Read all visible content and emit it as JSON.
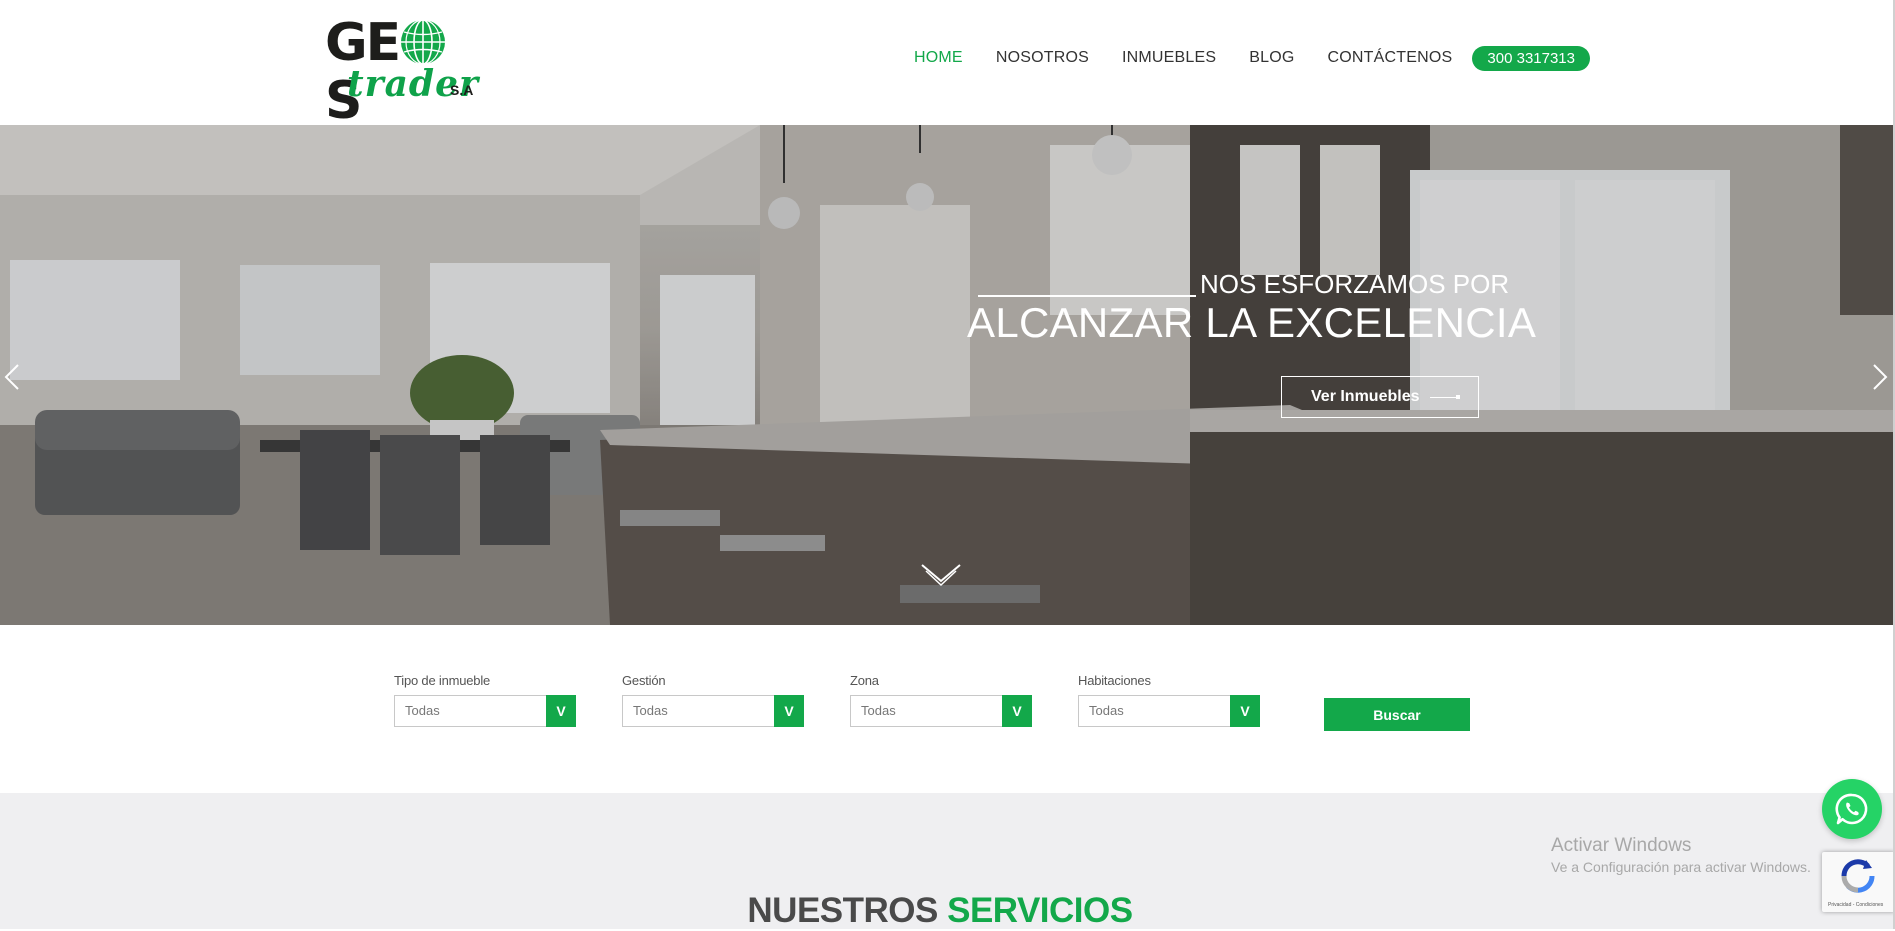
{
  "header": {
    "logo": {
      "brand_text_1": "GE",
      "brand_text_2": "S",
      "brand_text_sub": "trader",
      "brand_suffix": "S.A"
    },
    "nav": [
      {
        "label": "HOME",
        "active": true
      },
      {
        "label": "NOSOTROS",
        "active": false
      },
      {
        "label": "INMUEBLES",
        "active": false
      },
      {
        "label": "BLOG",
        "active": false
      },
      {
        "label": "CONTÁCTENOS",
        "active": false
      }
    ],
    "phone": "300 3317313"
  },
  "hero": {
    "subtitle": "NOS ESFORZAMOS POR",
    "title": "ALCANZAR LA EXCELENCIA",
    "button_label": "Ver Inmuebles",
    "icons": [
      "chevron-left-icon",
      "chevron-right-icon",
      "chevron-down-icon"
    ]
  },
  "search": {
    "filters": [
      {
        "label": "Tipo de inmueble",
        "value": "Todas",
        "caret": "V"
      },
      {
        "label": "Gestión",
        "value": "Todas",
        "caret": "V"
      },
      {
        "label": "Zona",
        "value": "Todas",
        "caret": "V"
      },
      {
        "label": "Habitaciones",
        "value": "Todas",
        "caret": "V"
      }
    ],
    "button_label": "Buscar"
  },
  "services": {
    "title_part1": "NUESTROS",
    "title_part2": "SERVICIOS"
  },
  "overlay": {
    "windows_title": "Activar Windows",
    "windows_sub": "Ve a Configuración para activar Windows.",
    "recaptcha_text": "Privacidad - Condiciones"
  },
  "colors": {
    "accent": "#13a84a",
    "text_dark": "#333333",
    "section_bg": "#efeff1",
    "whatsapp": "#25d366"
  }
}
